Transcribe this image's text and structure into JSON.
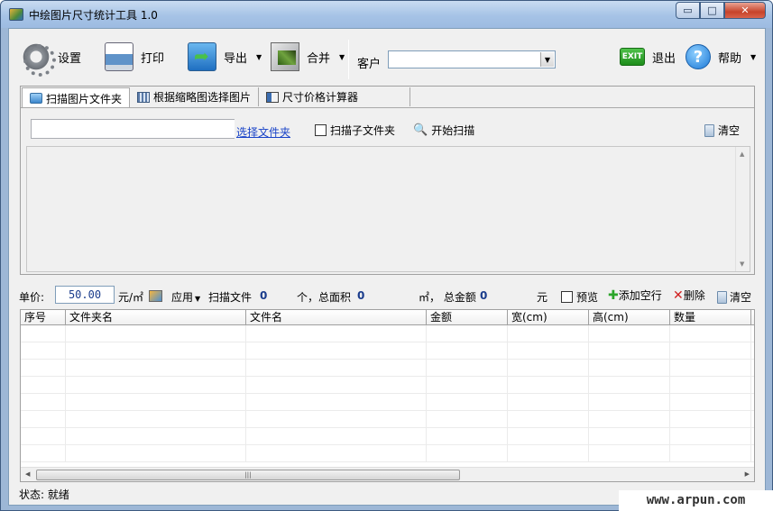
{
  "window": {
    "title": "中绘图片尺寸统计工具 1.0",
    "min_glyph": "▭",
    "max_glyph": "□",
    "close_glyph": "✕"
  },
  "toolbar": {
    "settings": "设置",
    "print": "打印",
    "export": "导出",
    "merge": "合并",
    "customer_label": "客户",
    "customer_value": "",
    "exit_icon_text": "EXIT",
    "exit": "退出",
    "help": "帮助",
    "dropdown_glyph": "▼"
  },
  "tabs": [
    {
      "label": "扫描图片文件夹",
      "active": true
    },
    {
      "label": "根据缩略图选择图片",
      "active": false
    },
    {
      "label": "尺寸价格计算器",
      "active": false
    }
  ],
  "scan": {
    "folder_path": "",
    "choose_folder": "选择文件夹",
    "include_subfolders": "扫描子文件夹",
    "start_scan": "开始扫描",
    "clear": "清空"
  },
  "stats": {
    "unit_price_label": "单价:",
    "unit_price": "50.00",
    "unit": "元/㎡",
    "apply": "应用",
    "scan_files_label": "扫描文件",
    "file_count": "0",
    "count_unit_total_area": "个，总面积",
    "total_area": "0",
    "area_unit_total_amount": "㎡， 总金额",
    "total_amount": "0",
    "currency": "元",
    "preview": "预览",
    "add_row": "添加空行",
    "delete": "删除",
    "clear": "清空"
  },
  "table": {
    "columns": [
      "序号",
      "文件夹名",
      "文件名",
      "金额",
      "宽(cm)",
      "高(cm)",
      "数量"
    ],
    "rows": []
  },
  "status": {
    "text": "状态: 就绪"
  },
  "watermark": "www.arpun.com"
}
